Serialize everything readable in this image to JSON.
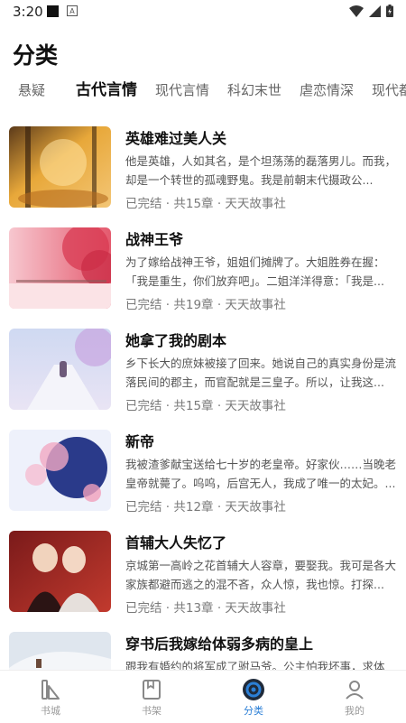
{
  "status": {
    "time": "3:20",
    "a_badge": "A"
  },
  "page_title": "分类",
  "tabs": [
    {
      "label": "悬疑"
    },
    {
      "label": "古代言情",
      "active": true
    },
    {
      "label": "现代言情"
    },
    {
      "label": "科幻末世"
    },
    {
      "label": "虐恋情深"
    },
    {
      "label": "现代都"
    }
  ],
  "books": [
    {
      "title": "英雄难过美人关",
      "desc": "他是英雄，人如其名，是个坦荡荡的磊落男儿。而我，却是一个转世的孤魂野鬼。我是前朝末代摄政公...",
      "meta": "已完结 · 共15章 · 天天故事社"
    },
    {
      "title": "战神王爷",
      "desc": "为了嫁给战神王爷，姐姐们摊牌了。大姐胜券在握：「我是重生，你们放弃吧」。二姐洋洋得意：「我是...",
      "meta": "已完结 · 共19章 · 天天故事社"
    },
    {
      "title": "她拿了我的剧本",
      "desc": "乡下长大的庶妹被接了回来。她说自己的真实身份是流落民间的郡主，而官配就是三皇子。所以，让我这...",
      "meta": "已完结 · 共15章 · 天天故事社"
    },
    {
      "title": "新帝",
      "desc": "我被渣爹献宝送给七十岁的老皇帝。好家伙……当晚老皇帝就薨了。呜呜，后宫无人，我成了唯一的太妃。...",
      "meta": "已完结 · 共12章 · 天天故事社"
    },
    {
      "title": "首辅大人失忆了",
      "desc": "京城第一高岭之花首辅大人容章，要娶我。我可是各大家族都避而逃之的混不吝，众人惊，我也惊。打探...",
      "meta": "已完结 · 共13章 · 天天故事社"
    },
    {
      "title": "穿书后我嫁给体弱多病的皇上",
      "desc": "跟我有婚约的将军成了驸马爷。公主怕我坏事，求体",
      "meta": ""
    }
  ],
  "nav": [
    {
      "label": "书城"
    },
    {
      "label": "书架"
    },
    {
      "label": "分类",
      "active": true
    },
    {
      "label": "我的"
    }
  ],
  "colors": {
    "accent": "#2b7fd6",
    "inactive": "#999999"
  }
}
